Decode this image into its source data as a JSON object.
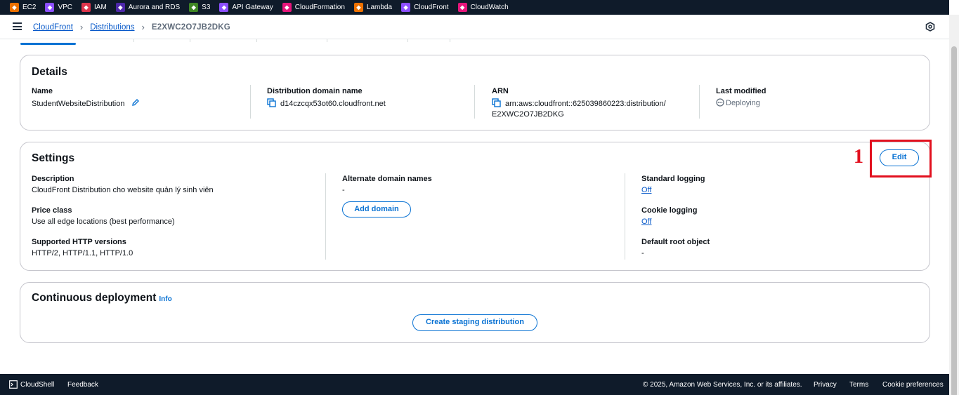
{
  "favorites": [
    {
      "label": "EC2",
      "icon": "ec2-icon",
      "color": "#ed7100"
    },
    {
      "label": "VPC",
      "icon": "vpc-icon",
      "color": "#8c4fff"
    },
    {
      "label": "IAM",
      "icon": "iam-icon",
      "color": "#dd344c"
    },
    {
      "label": "Aurora and RDS",
      "icon": "rds-icon",
      "color": "#4d27aa"
    },
    {
      "label": "S3",
      "icon": "s3-icon",
      "color": "#3f8624"
    },
    {
      "label": "API Gateway",
      "icon": "api-gateway-icon",
      "color": "#8c4fff"
    },
    {
      "label": "CloudFormation",
      "icon": "cloudformation-icon",
      "color": "#e7157b"
    },
    {
      "label": "Lambda",
      "icon": "lambda-icon",
      "color": "#ed7100"
    },
    {
      "label": "CloudFront",
      "icon": "cloudfront-icon",
      "color": "#8c4fff"
    },
    {
      "label": "CloudWatch",
      "icon": "cloudwatch-icon",
      "color": "#e7157b"
    }
  ],
  "breadcrumb": {
    "root": "CloudFront",
    "section": "Distributions",
    "current": "E2XWC2O7JB2DKG"
  },
  "details": {
    "title": "Details",
    "name_label": "Name",
    "name_value": "StudentWebsiteDistribution",
    "domain_label": "Distribution domain name",
    "domain_value": "d14czcqx53ot60.cloudfront.net",
    "arn_label": "ARN",
    "arn_line1": "arn:aws:cloudfront::625039860223:distribution/",
    "arn_line2": "E2XWC2O7JB2DKG",
    "modified_label": "Last modified",
    "modified_value": "Deploying"
  },
  "settings": {
    "title": "Settings",
    "edit_label": "Edit",
    "description_label": "Description",
    "description_value": "CloudFront Distribution cho website quản lý sinh viên",
    "price_label": "Price class",
    "price_value": "Use all edge locations (best performance)",
    "http_label": "Supported HTTP versions",
    "http_value": "HTTP/2, HTTP/1.1, HTTP/1.0",
    "alt_label": "Alternate domain names",
    "alt_value": "-",
    "add_domain_label": "Add domain",
    "std_logging_label": "Standard logging",
    "std_logging_value": "Off",
    "cookie_label": "Cookie logging",
    "cookie_value": "Off",
    "root_label": "Default root object",
    "root_value": "-"
  },
  "deployment": {
    "title": "Continuous deployment",
    "info_label": "Info",
    "create_label": "Create staging distribution"
  },
  "annotation": {
    "number": "1",
    "color": "#e2101e"
  },
  "footer": {
    "cloudshell": "CloudShell",
    "feedback": "Feedback",
    "copyright": "© 2025, Amazon Web Services, Inc. or its affiliates.",
    "privacy": "Privacy",
    "terms": "Terms",
    "cookies": "Cookie preferences"
  }
}
